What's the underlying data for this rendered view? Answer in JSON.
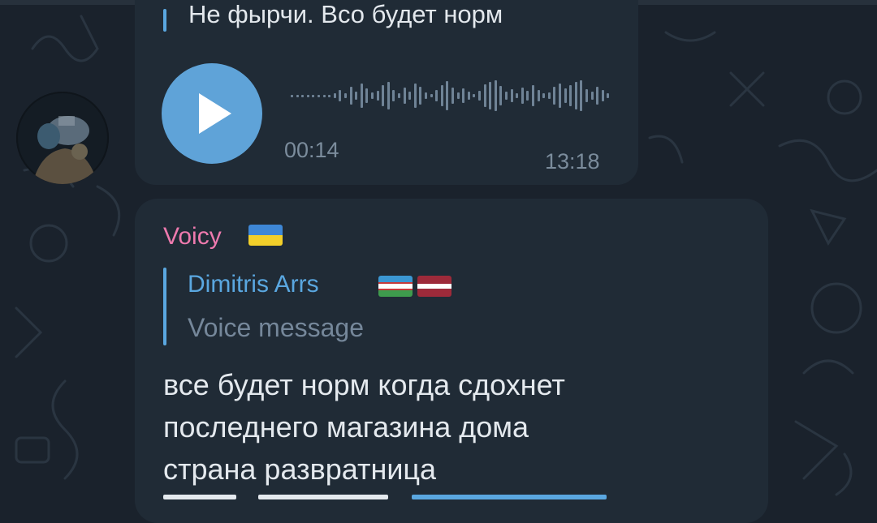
{
  "voice_message": {
    "reply_quote": "Не фырчи. Всо будет норм",
    "duration": "00:14",
    "time": "13:18"
  },
  "message": {
    "sender": "Voicy",
    "sender_flag": "ukraine-flag",
    "reply": {
      "author": "Dimitris Arrs",
      "author_flags": [
        "uzbekistan-flag",
        "latvia-flag"
      ],
      "preview": "Voice message"
    },
    "lines": [
      "все будет норм когда сдохнет",
      "последнего магазина дома",
      "страна развратница"
    ]
  },
  "colors": {
    "background": "#1a222c",
    "bubble": "#202b36",
    "accent_blue": "#5aa7e0",
    "sender_pink": "#ee7aae"
  }
}
